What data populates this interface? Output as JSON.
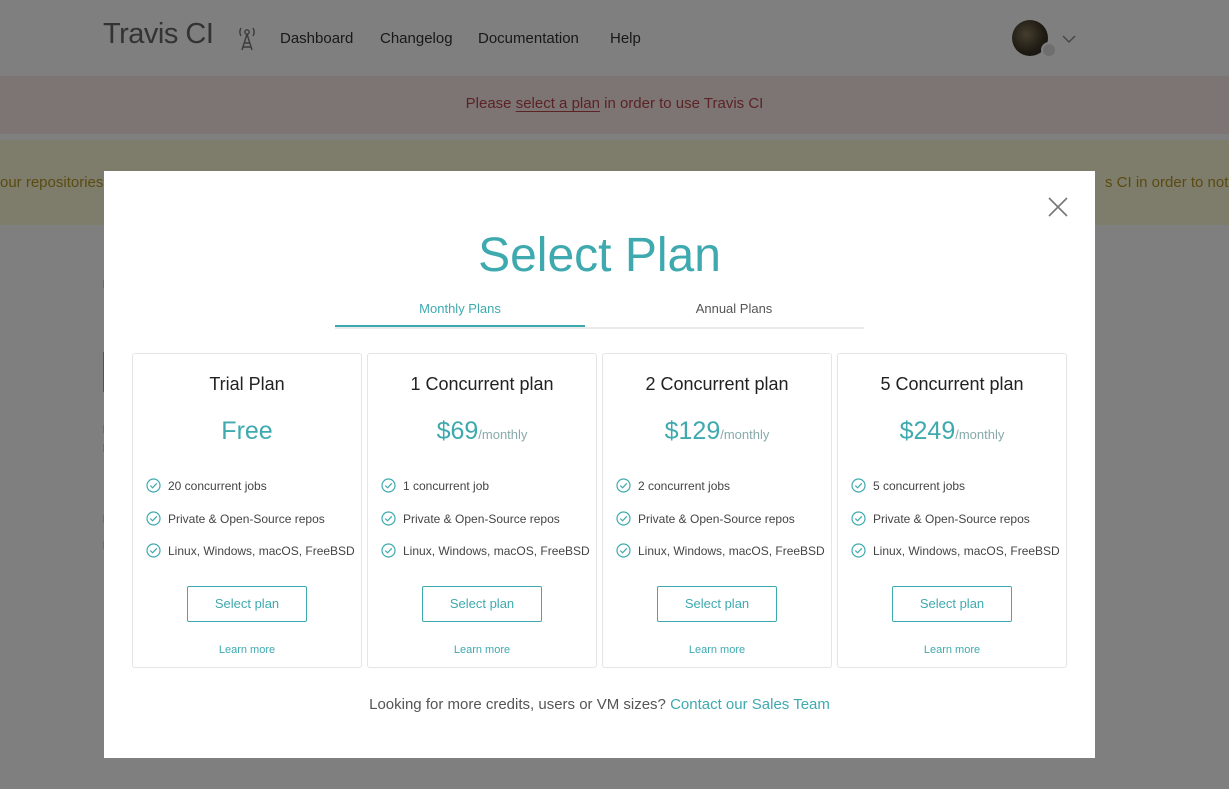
{
  "header": {
    "brand": "Travis CI",
    "nav": [
      "Dashboard",
      "Changelog",
      "Documentation",
      "Help"
    ]
  },
  "alert_red": {
    "prefix": "Please ",
    "link": "select a plan",
    "suffix": " in order to use Travis CI"
  },
  "alert_yellow": {
    "left_fragment": "our repositories",
    "right_fragment": "s CI in order to not b"
  },
  "modal": {
    "title": "Select Plan",
    "tabs": [
      "Monthly Plans",
      "Annual Plans"
    ],
    "active_tab": "Monthly Plans",
    "plans": [
      {
        "name": "Trial Plan",
        "price": "Free",
        "period": "",
        "features": [
          "20 concurrent jobs",
          "Private & Open-Source repos",
          "Linux, Windows, macOS, FreeBSD"
        ],
        "button": "Select plan",
        "learn_more": "Learn more"
      },
      {
        "name": "1 Concurrent plan",
        "price": "$69",
        "period": "/monthly",
        "features": [
          "1 concurrent job",
          "Private & Open-Source repos",
          "Linux, Windows, macOS, FreeBSD"
        ],
        "button": "Select plan",
        "learn_more": "Learn more"
      },
      {
        "name": "2 Concurrent plan",
        "price": "$129",
        "period": "/monthly",
        "features": [
          "2 concurrent jobs",
          "Private & Open-Source repos",
          "Linux, Windows, macOS, FreeBSD"
        ],
        "button": "Select plan",
        "learn_more": "Learn more"
      },
      {
        "name": "5 Concurrent plan",
        "price": "$249",
        "period": "/monthly",
        "features": [
          "5 concurrent jobs",
          "Private & Open-Source repos",
          "Linux, Windows, macOS, FreeBSD"
        ],
        "button": "Select plan",
        "learn_more": "Learn more"
      }
    ],
    "footer_text": "Looking for more credits, users or VM sizes? ",
    "footer_link": "Contact our Sales Team"
  },
  "colors": {
    "accent": "#3eaaaf",
    "alert_red_bg": "#fbe9e9",
    "alert_red_text": "#b7464b",
    "alert_yellow_bg": "#fdf8d6",
    "alert_yellow_text": "#b49722",
    "overlay": "rgba(0,0,0,0.5)"
  },
  "icons": [
    "broadcast-tower-icon",
    "chevron-down-icon",
    "close-icon",
    "check-circle-icon",
    "github-icon"
  ]
}
